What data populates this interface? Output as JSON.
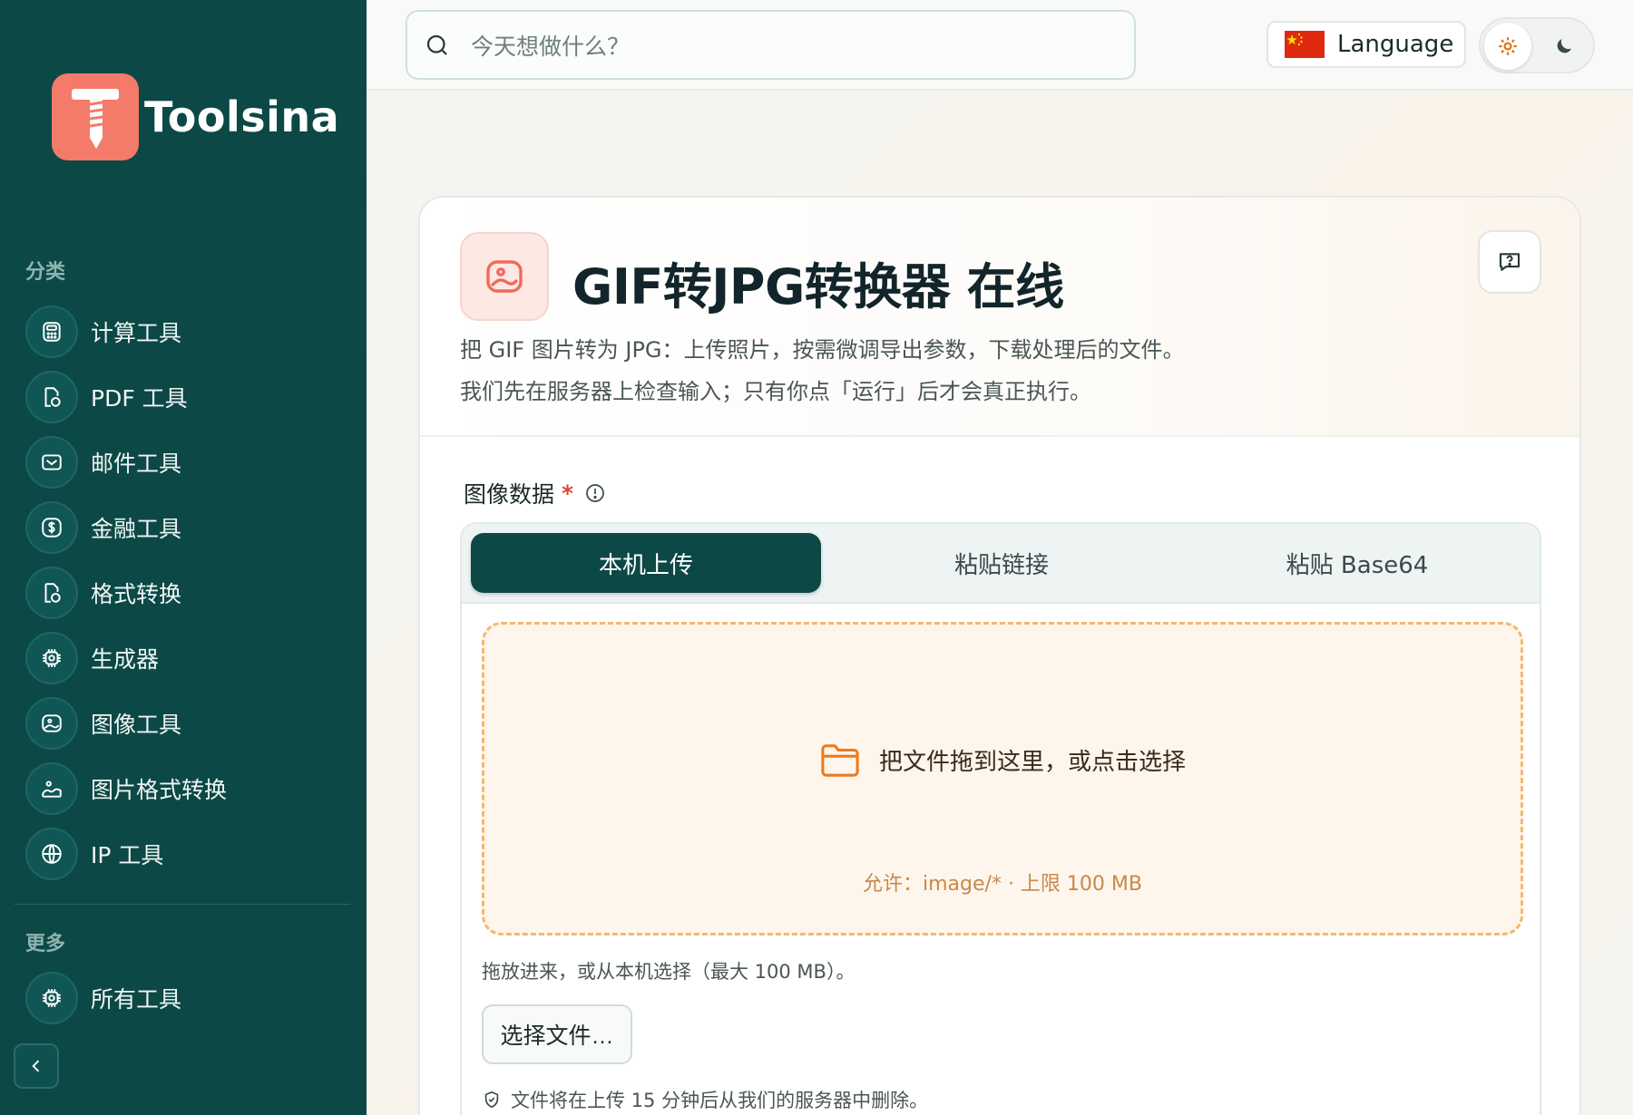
{
  "brand": {
    "name": "Toolsina",
    "color": "#f47a6a"
  },
  "sidebar": {
    "categories_label": "分类",
    "items": [
      {
        "label": "计算工具",
        "icon": "calculator-icon"
      },
      {
        "label": "PDF 工具",
        "icon": "file-icon"
      },
      {
        "label": "邮件工具",
        "icon": "mail-icon"
      },
      {
        "label": "金融工具",
        "icon": "dollar-icon"
      },
      {
        "label": "格式转换",
        "icon": "file-icon"
      },
      {
        "label": "生成器",
        "icon": "chip-icon"
      },
      {
        "label": "图像工具",
        "icon": "image-icon"
      },
      {
        "label": "图片格式转换",
        "icon": "image-convert-icon"
      },
      {
        "label": "IP 工具",
        "icon": "globe-icon"
      }
    ],
    "more_label": "更多",
    "all_tools_label": "所有工具"
  },
  "topbar": {
    "search_placeholder": "今天想做什么？",
    "language_label": "Language"
  },
  "tool": {
    "title": "GIF转JPG转换器 在线",
    "description_1": "把 GIF 图片转为 JPG：上传照片，按需微调导出参数，下载处理后的文件。",
    "description_2": "我们先在服务器上检查输入；只有你点「运行」后才会真正执行。",
    "field_label": "图像数据",
    "required_mark": "*",
    "tabs": [
      {
        "label": "本机上传",
        "active": true
      },
      {
        "label": "粘贴链接",
        "active": false
      },
      {
        "label": "粘贴 Base64",
        "active": false
      }
    ],
    "drop_text": "把文件拖到这里，或点击选择",
    "drop_hint": "允许：image/* · 上限 100 MB",
    "upload_note": "拖放进来，或从本机选择（最大 100 MB）。",
    "choose_button": "选择文件…",
    "delete_note": "文件将在上传 15 分钟后从我们的服务器中删除。"
  },
  "colors": {
    "sidebar_bg": "#0c4846",
    "accent_orange": "#f4b870",
    "primary": "#0c4846"
  }
}
